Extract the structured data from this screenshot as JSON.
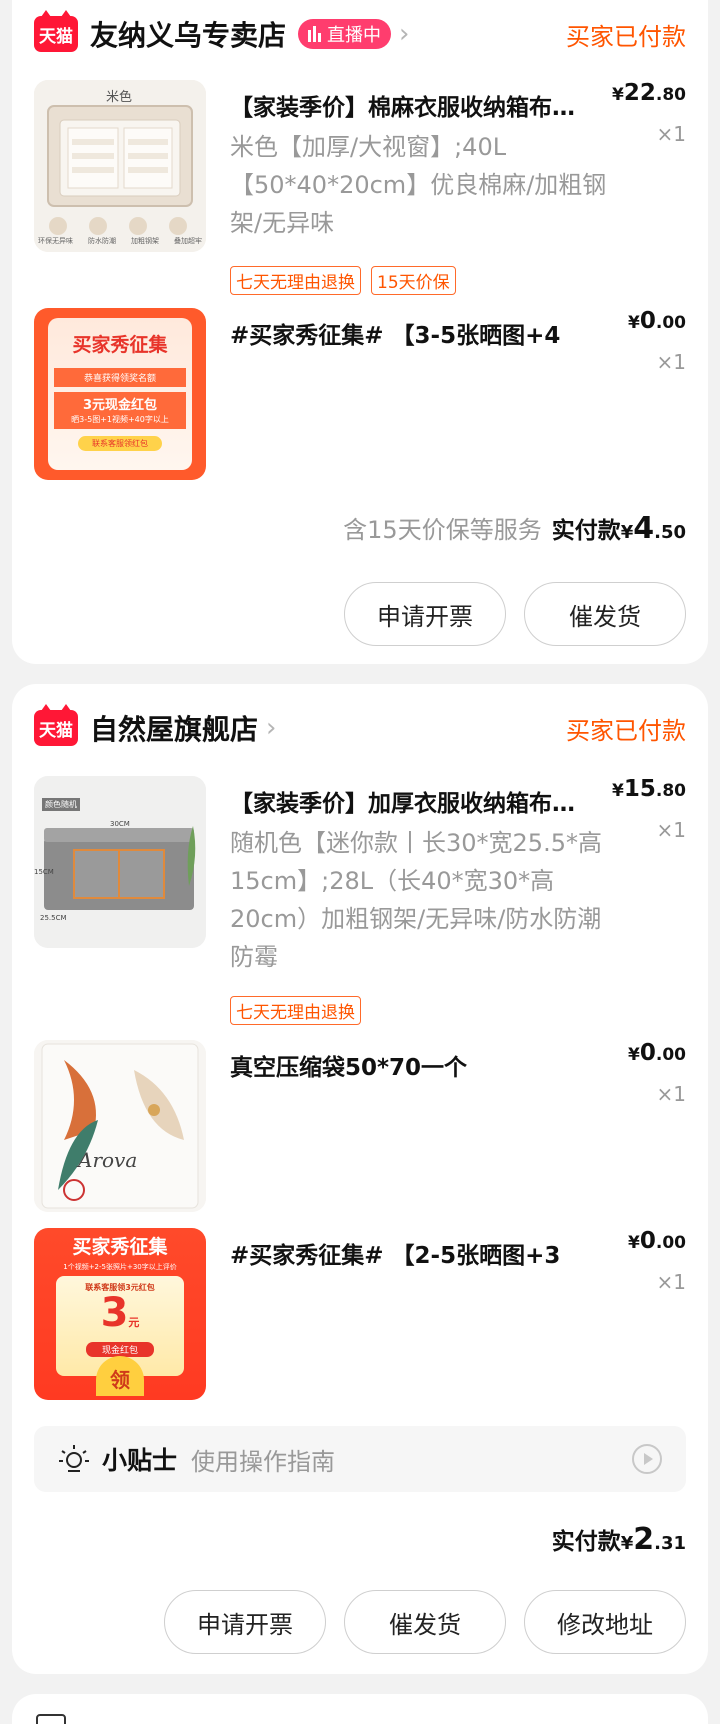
{
  "order1": {
    "shop_name": "友纳义乌专卖店",
    "tmall_logo": "天猫",
    "live_badge": "直播中",
    "status": "买家已付款",
    "items": [
      {
        "title": "【家装季价】棉麻衣服收纳箱布艺整理箱",
        "sku": "米色【加厚/大视窗】;40L【50*40*20cm】优良棉麻/加粗钢架/无异味",
        "price_symbol": "¥",
        "price_int": "22",
        "price_dec": ".80",
        "qty": "×1",
        "thumb_label": "米色",
        "thumb_captions": [
          "环保无异味",
          "防水防潮",
          "加粗钢架",
          "叠加超牢"
        ],
        "tags": [
          "七天无理由退换",
          "15天价保"
        ]
      },
      {
        "title": "#买家秀征集# 【3-5张晒图+4",
        "price_symbol": "¥",
        "price_int": "0",
        "price_dec": ".00",
        "qty": "×1",
        "promo": {
          "headline": "买家秀征集",
          "sub": "恭喜获得领奖名额",
          "reward": "3元现金红包",
          "rule": "晒3-5图+1视频+40字以上",
          "cta": "联系客服领红包"
        }
      }
    ],
    "service_text": "含15天价保等服务",
    "paid_label": "实付款",
    "paid_symbol": "¥",
    "paid_int": "4",
    "paid_dec": ".50",
    "buttons": [
      "申请开票",
      "催发货"
    ]
  },
  "order2": {
    "shop_name": "自然屋旗舰店",
    "tmall_logo": "天猫",
    "status": "买家已付款",
    "items": [
      {
        "title": "【家装季价】加厚衣服收纳箱布艺整理箱",
        "sku": "随机色【迷你款丨长30*宽25.5*高15cm】;28L（长40*宽30*高20cm）加粗钢架/无异味/防水防潮防霉",
        "price_symbol": "¥",
        "price_int": "15",
        "price_dec": ".80",
        "qty": "×1",
        "thumb_label": "颜色随机",
        "thumb_dims": [
          "30CM",
          "15CM",
          "25.5CM"
        ],
        "tags": [
          "七天无理由退换"
        ]
      },
      {
        "title": "真空压缩袋50*70一个",
        "price_symbol": "¥",
        "price_int": "0",
        "price_dec": ".00",
        "qty": "×1",
        "thumb_script": "Arova"
      },
      {
        "title": "#买家秀征集# 【2-5张晒图+3",
        "price_symbol": "¥",
        "price_int": "0",
        "price_dec": ".00",
        "qty": "×1",
        "promo": {
          "headline": "买家秀征集",
          "rule": "1个视频+2-5张照片+30字以上评价",
          "cta": "联系客服领3元红包",
          "amount": "3",
          "unit": "元",
          "reward": "现金红包",
          "button": "领"
        }
      }
    ],
    "tips_title": "小贴士",
    "tips_text": "使用操作指南",
    "paid_label": "实付款",
    "paid_symbol": "¥",
    "paid_int": "2",
    "paid_dec": ".31",
    "buttons": [
      "申请开票",
      "催发货",
      "修改地址"
    ]
  },
  "colors": {
    "accent_orange": "#ff5500",
    "tmall_red": "#ff1736",
    "live_pink": "#ff3d6e",
    "muted_text": "#999999"
  }
}
